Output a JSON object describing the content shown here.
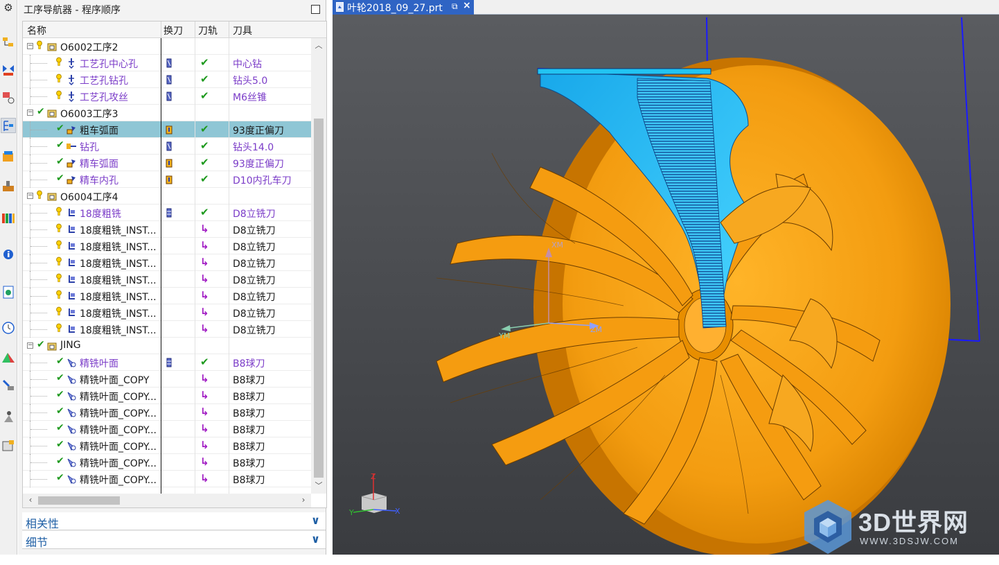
{
  "navigator": {
    "title": "工序导航器 - 程序顺序",
    "columns": {
      "name": "名称",
      "change_tool": "换刀",
      "path": "刀轨",
      "tool": "刀具"
    },
    "sections": {
      "dependencies": "相关性",
      "details": "细节"
    }
  },
  "rows": [
    {
      "name": "O6002工序2",
      "kind": "group",
      "status": "pending",
      "tool": "",
      "color": "dark"
    },
    {
      "name": "工艺孔中心孔",
      "kind": "drill",
      "status": "pending",
      "change_tool": "tool-change-icon",
      "path": "check",
      "tool": "中心钻",
      "color": "purple"
    },
    {
      "name": "工艺孔钻孔",
      "kind": "drill",
      "status": "pending",
      "change_tool": "tool-change-icon",
      "path": "check",
      "tool": "钻头5.0",
      "color": "purple"
    },
    {
      "name": "工艺孔攻丝",
      "kind": "drill",
      "status": "pending",
      "change_tool": "tool-change-icon",
      "path": "check",
      "tool": "M6丝锥",
      "color": "purple"
    },
    {
      "name": "O6003工序3",
      "kind": "group",
      "status": "complete",
      "tool": "",
      "color": "dark"
    },
    {
      "name": "粗车弧面",
      "kind": "turn",
      "status": "complete",
      "change_tool": "turn-tool-icon",
      "path": "check",
      "tool": "93度正偏刀",
      "color": "dark",
      "selected": true
    },
    {
      "name": "钻孔",
      "kind": "turn-drill",
      "status": "complete",
      "change_tool": "tool-change-icon",
      "path": "check",
      "tool": "钻头14.0",
      "color": "purple"
    },
    {
      "name": "精车弧面",
      "kind": "turn",
      "status": "complete",
      "change_tool": "turn-tool-icon",
      "path": "check",
      "tool": "93度正偏刀",
      "color": "purple"
    },
    {
      "name": "精车内孔",
      "kind": "turn",
      "status": "complete",
      "change_tool": "turn-tool-icon",
      "path": "check",
      "tool": "D10内孔车刀",
      "color": "purple"
    },
    {
      "name": "O6004工序4",
      "kind": "group",
      "status": "pending",
      "tool": "",
      "color": "dark"
    },
    {
      "name": "18度粗铣",
      "kind": "mill",
      "status": "pending",
      "change_tool": "mill-tool-icon",
      "path": "check",
      "tool": "D8立铣刀",
      "color": "purple"
    },
    {
      "name": "18度粗铣_INST...",
      "kind": "mill",
      "status": "pending",
      "path": "ref",
      "tool": "D8立铣刀",
      "color": "dark"
    },
    {
      "name": "18度粗铣_INST...",
      "kind": "mill",
      "status": "pending",
      "path": "ref",
      "tool": "D8立铣刀",
      "color": "dark"
    },
    {
      "name": "18度粗铣_INST...",
      "kind": "mill",
      "status": "pending",
      "path": "ref",
      "tool": "D8立铣刀",
      "color": "dark"
    },
    {
      "name": "18度粗铣_INST...",
      "kind": "mill",
      "status": "pending",
      "path": "ref",
      "tool": "D8立铣刀",
      "color": "dark"
    },
    {
      "name": "18度粗铣_INST...",
      "kind": "mill",
      "status": "pending",
      "path": "ref",
      "tool": "D8立铣刀",
      "color": "dark"
    },
    {
      "name": "18度粗铣_INST...",
      "kind": "mill",
      "status": "pending",
      "path": "ref",
      "tool": "D8立铣刀",
      "color": "dark"
    },
    {
      "name": "18度粗铣_INST...",
      "kind": "mill",
      "status": "pending",
      "path": "ref",
      "tool": "D8立铣刀",
      "color": "dark"
    },
    {
      "name": "JING",
      "kind": "group",
      "status": "complete",
      "tool": "",
      "color": "dark"
    },
    {
      "name": "精铣叶面",
      "kind": "finish",
      "status": "complete",
      "change_tool": "mill-tool-icon",
      "path": "check",
      "tool": "B8球刀",
      "color": "purple"
    },
    {
      "name": "精铣叶面_COPY",
      "kind": "finish",
      "status": "complete",
      "path": "ref",
      "tool": "B8球刀",
      "color": "dark"
    },
    {
      "name": "精铣叶面_COPY...",
      "kind": "finish",
      "status": "complete",
      "path": "ref",
      "tool": "B8球刀",
      "color": "dark"
    },
    {
      "name": "精铣叶面_COPY...",
      "kind": "finish",
      "status": "complete",
      "path": "ref",
      "tool": "B8球刀",
      "color": "dark"
    },
    {
      "name": "精铣叶面_COPY...",
      "kind": "finish",
      "status": "complete",
      "path": "ref",
      "tool": "B8球刀",
      "color": "dark"
    },
    {
      "name": "精铣叶面_COPY...",
      "kind": "finish",
      "status": "complete",
      "path": "ref",
      "tool": "B8球刀",
      "color": "dark"
    },
    {
      "name": "精铣叶面_COPY...",
      "kind": "finish",
      "status": "complete",
      "path": "ref",
      "tool": "B8球刀",
      "color": "dark"
    },
    {
      "name": "精铣叶面_COPY...",
      "kind": "finish",
      "status": "complete",
      "path": "ref",
      "tool": "B8球刀",
      "color": "dark"
    }
  ],
  "graphics": {
    "file_tab": "叶轮2018_09_27.prt",
    "pin_glyph": "⧉",
    "close_glyph": "×",
    "wcs_labels": {
      "x": "XM",
      "y": "YM",
      "z": "ZM"
    },
    "triad_labels": {
      "x": "X",
      "y": "Y",
      "z": "Z"
    }
  },
  "watermark": {
    "main": "3D世界网",
    "sub": "WWW.3DSJW.COM"
  },
  "colors": {
    "accent": "#2f64c4",
    "selection": "#8fc6d5",
    "part_orange": "#f5a010",
    "toolpath_cyan": "#22c4f2",
    "bounding_blue": "#1a1aff",
    "viewport_bg": "#3f4145",
    "op_purple": "#7b3cc8",
    "check_green": "#1f9a1f"
  }
}
